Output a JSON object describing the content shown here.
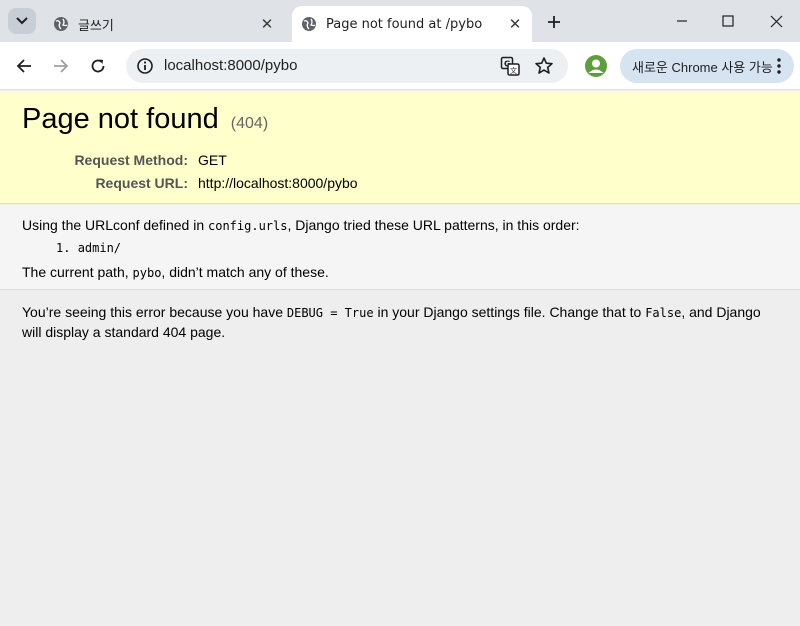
{
  "browser": {
    "tabs": [
      {
        "title": "글쓰기",
        "active": false
      },
      {
        "title": "Page not found at /pybo",
        "active": true
      }
    ],
    "url": "localhost:8000/pybo",
    "update_button": "새로운 Chrome 사용 가능",
    "icons": {
      "tab_search": "chevron-down-icon",
      "favicon": "globe-icon",
      "close": "close-icon",
      "new_tab": "plus-icon",
      "back": "arrow-left-icon",
      "forward": "arrow-right-icon",
      "reload": "reload-icon",
      "site_info": "info-icon",
      "translate": "translate-icon",
      "bookmark": "star-icon",
      "profile": "profile-icon",
      "menu": "more-vertical-icon"
    },
    "colors": {
      "tabstrip": "#dfe3e7",
      "update_pill": "#d6e4f2",
      "profile": "#5f9e3c"
    }
  },
  "error_page": {
    "title": "Page not found",
    "status": "(404)",
    "request_method_label": "Request Method:",
    "request_method": "GET",
    "request_url_label": "Request URL:",
    "request_url": "http://localhost:8000/pybo",
    "urlconf_prefix": "Using the URLconf defined in ",
    "urlconf_name": "config.urls",
    "urlconf_suffix": ", Django tried these URL patterns, in this order:",
    "patterns": [
      {
        "index": "1.",
        "pattern": "admin/"
      }
    ],
    "current_path_prefix": "The current path, ",
    "current_path": "pybo",
    "current_path_suffix": ", didn’t match any of these.",
    "explanation_part1": "You’re seeing this error because you have ",
    "debug_code": "DEBUG = True",
    "explanation_part2": " in your Django settings file. Change that to ",
    "false_code": "False",
    "explanation_part3": ", and Django will display a standard 404 page.",
    "colors": {
      "summary_bg": "#ffffcc",
      "info_bg": "#f5f5f5",
      "page_bg": "#eeeeee"
    }
  }
}
